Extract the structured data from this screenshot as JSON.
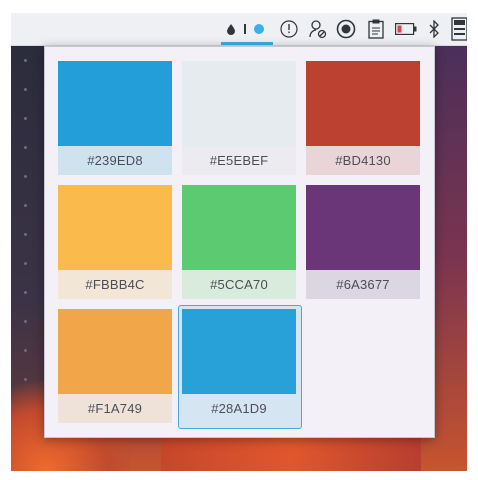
{
  "panel": {
    "tray_icons": [
      "water-drop-icon",
      "divider-icon",
      "dot-icon",
      "info-circle-icon",
      "user-settings-icon",
      "moon-circle-icon",
      "clipboard-icon",
      "battery-low-icon",
      "bluetooth-icon",
      "keyboard-layout-icon"
    ],
    "accent_color": "#3DAEE9"
  },
  "color_picker": {
    "swatches": [
      {
        "hex": "#239ED8",
        "label": "#239ED8"
      },
      {
        "hex": "#E5EBEF",
        "label": "#E5EBEF"
      },
      {
        "hex": "#BD4130",
        "label": "#BD4130"
      },
      {
        "hex": "#FBBB4C",
        "label": "#FBBB4C"
      },
      {
        "hex": "#5CCA70",
        "label": "#5CCA70"
      },
      {
        "hex": "#6A3677",
        "label": "#6A3677"
      },
      {
        "hex": "#F1A749",
        "label": "#F1A749"
      },
      {
        "hex": "#28A1D9",
        "label": "#28A1D9"
      }
    ],
    "selected": "#28A1D9"
  }
}
